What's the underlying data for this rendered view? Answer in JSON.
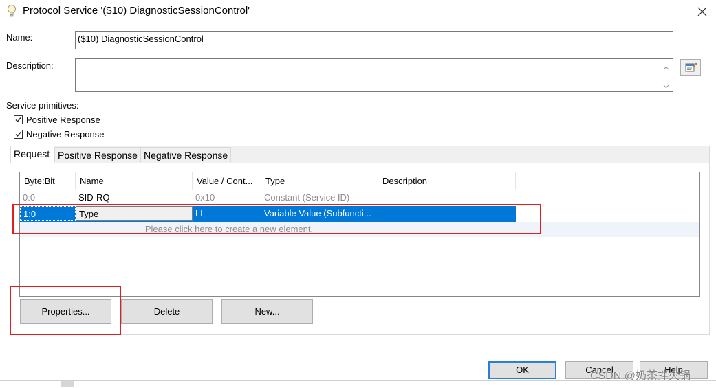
{
  "window": {
    "title": "Protocol Service '($10) DiagnosticSessionControl'",
    "title_icon": "lightbulb-icon",
    "close_icon": "close-icon"
  },
  "form": {
    "name_label": "Name:",
    "name_value": "($10) DiagnosticSessionControl",
    "description_label": "Description:",
    "description_value": "",
    "description_edit_icon": "edit-description-icon",
    "primitives_label": "Service primitives:",
    "primitives": [
      {
        "label": "Positive Response",
        "checked": true
      },
      {
        "label": "Negative Response",
        "checked": true
      }
    ]
  },
  "tabs": [
    {
      "label": "Request",
      "active": true
    },
    {
      "label": "Positive Response",
      "active": false
    },
    {
      "label": "Negative Response",
      "active": false
    }
  ],
  "table": {
    "columns": [
      "Byte:Bit",
      "Name",
      "Value / Cont...",
      "Type",
      "Description"
    ],
    "rows": [
      {
        "byte_bit": "0:0",
        "name": "SID-RQ",
        "value": "0x10",
        "type": "Constant (Service ID)",
        "description": "",
        "state": "disabled"
      },
      {
        "byte_bit": "1:0",
        "name": "Type",
        "value": "LL",
        "type": "Variable Value (Subfuncti...",
        "description": "",
        "state": "selected"
      }
    ],
    "new_element_hint": "Please click here to create a new element."
  },
  "element_buttons": {
    "properties": "Properties...",
    "delete": "Delete",
    "new": "New..."
  },
  "dialog_buttons": {
    "ok": "OK",
    "cancel": "Cancel",
    "help": "Help"
  },
  "watermark": "CSDN @奶茶拌火锅",
  "colors": {
    "selection": "#0078d7",
    "annotation_red": "#e02020",
    "primary_border": "#2a7fd4"
  }
}
